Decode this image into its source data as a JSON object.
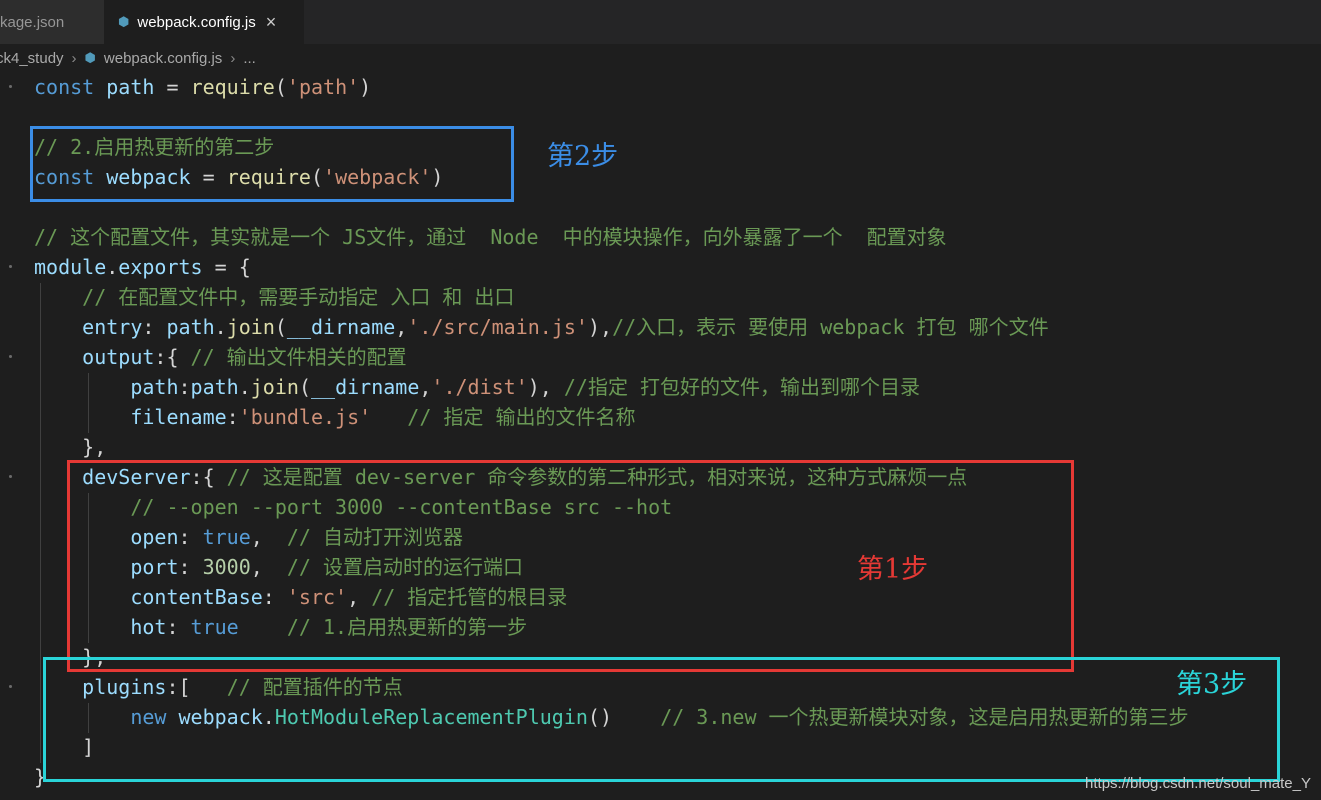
{
  "tabs": [
    {
      "label": "kage.json",
      "active": false
    },
    {
      "label": "webpack.config.js",
      "active": true,
      "icon": "webpack-cube-icon",
      "close": "×"
    }
  ],
  "breadcrumb": {
    "items": [
      "ck4_study",
      "webpack.config.js",
      "..."
    ],
    "separator": "›"
  },
  "annotations": {
    "step1": {
      "label": "第1步",
      "color": "#e53935"
    },
    "step2": {
      "label": "第2步",
      "color": "#3b8de6"
    },
    "step3": {
      "label": "第3步",
      "color": "#2ad4d8"
    }
  },
  "code": {
    "l1": {
      "kw": "const",
      "var": "path",
      "eq": " = ",
      "fn": "require",
      "p1": "(",
      "str": "'path'",
      "p2": ")"
    },
    "l3": {
      "cm": "// 2.启用热更新的第二步"
    },
    "l4": {
      "kw": "const",
      "var": "webpack",
      "eq": " = ",
      "fn": "require",
      "p1": "(",
      "str": "'webpack'",
      "p2": ")"
    },
    "l6": {
      "cm": "// 这个配置文件，其实就是一个 JS文件，通过  Node  中的模块操作，向外暴露了一个  配置对象"
    },
    "l7": {
      "var1": "module",
      "dot": ".",
      "var2": "exports",
      "rest": " = {"
    },
    "l8": {
      "cm": "// 在配置文件中，需要手动指定 入口 和 出口"
    },
    "l9": {
      "key": "entry",
      "c1": ": ",
      "var": "path",
      "dot": ".",
      "fn": "join",
      "p1": "(",
      "var2": "__dirname",
      "comma": ",",
      "str": "'./src/main.js'",
      "p2": "),",
      "cm": "//入口，表示 要使用 webpack 打包 哪个文件"
    },
    "l10": {
      "key": "output",
      "c1": ":{ ",
      "cm": "// 输出文件相关的配置"
    },
    "l11": {
      "key": "path",
      "c1": ":",
      "var": "path",
      "dot": ".",
      "fn": "join",
      "p1": "(",
      "var2": "__dirname",
      "comma": ",",
      "str": "'./dist'",
      "p2": "), ",
      "cm": "//指定 打包好的文件，输出到哪个目录"
    },
    "l12": {
      "key": "filename",
      "c1": ":",
      "str": "'bundle.js'",
      "sp": "   ",
      "cm": "// 指定 输出的文件名称"
    },
    "l13": {
      "pn": "},"
    },
    "l14": {
      "key": "devServer",
      "c1": ":{ ",
      "cm": "// 这是配置 dev-server 命令参数的第二种形式，相对来说，这种方式麻烦一点"
    },
    "l15": {
      "cm": "// --open --port 3000 --contentBase src --hot"
    },
    "l16": {
      "key": "open",
      "c1": ": ",
      "kw": "true",
      "c2": ",  ",
      "cm": "// 自动打开浏览器"
    },
    "l17": {
      "key": "port",
      "c1": ": ",
      "num": "3000",
      "c2": ",  ",
      "cm": "// 设置启动时的运行端口"
    },
    "l18": {
      "key": "contentBase",
      "c1": ": ",
      "str": "'src'",
      "c2": ", ",
      "cm": "// 指定托管的根目录"
    },
    "l19": {
      "key": "hot",
      "c1": ": ",
      "kw": "true",
      "c2": "    ",
      "cm": "// 1.启用热更新的第一步"
    },
    "l20": {
      "pn": "},"
    },
    "l21": {
      "key": "plugins",
      "c1": ":[   ",
      "cm": "// 配置插件的节点"
    },
    "l22": {
      "kw": "new",
      "sp": " ",
      "var": "webpack",
      "dot": ".",
      "cls": "HotModuleReplacementPlugin",
      "p": "()",
      "sp2": "    ",
      "cm": "// 3.new 一个热更新模块对象，这是启用热更新的第三步"
    },
    "l23": {
      "pn": "]"
    },
    "l24": {
      "pn": "}"
    }
  },
  "watermark": "https://blog.csdn.net/soul_mate_Y",
  "colors": {
    "background": "#1e1e1e",
    "keyword": "#569cd6",
    "variable": "#9cdcfe",
    "function": "#dcdcaa",
    "string": "#ce9178",
    "comment": "#6a9955",
    "number": "#b5cea8",
    "class": "#4ec9b0"
  }
}
